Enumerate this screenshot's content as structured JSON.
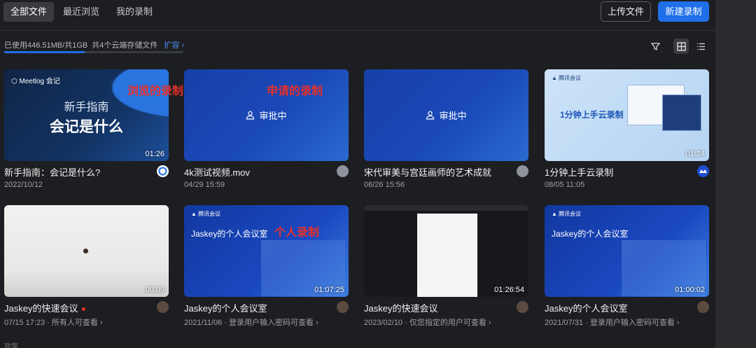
{
  "tabs": [
    {
      "label": "全部文件",
      "active": true
    },
    {
      "label": "最近浏览",
      "active": false
    },
    {
      "label": "我的录制",
      "active": false
    }
  ],
  "actions": {
    "upload": "上传文件",
    "new_recording": "新建录制"
  },
  "storage": {
    "used": "已使用446.51MB/共1GB",
    "count": "共4个云端存储文件",
    "expand": "扩容",
    "progress_fraction": 0.45
  },
  "annotations": {
    "browse": "浏览的录制",
    "apply": "申请的录制",
    "personal": "个人录制"
  },
  "cards": [
    {
      "thumb_title_small": "Meetlog 会记",
      "thumb_big_1": "新手指南",
      "thumb_big_2": "会记是什么",
      "duration": "01:26",
      "title": "新手指南：会记是什么?",
      "meta": "2022/10/12"
    },
    {
      "approval": "审批中",
      "title": "4k测试视频.mov",
      "meta": "04/29 15:59"
    },
    {
      "approval": "审批中",
      "title": "宋代审美与宫廷画师的艺术成就",
      "meta": "06/26 15:56"
    },
    {
      "thumb_logo": "腾讯会议",
      "thumb_caption": "1分钟上手云录制",
      "duration": "01:24",
      "title": "1分钟上手云录制",
      "meta": "08/05 11:05"
    },
    {
      "duration": "00:09",
      "title": "Jaskey的快速会议",
      "meta": "07/15 17:23 · 所有人可查看"
    },
    {
      "thumb_logo": "腾讯会议",
      "thumb_caption": "Jaskey的个人会议室",
      "duration": "01:07:25",
      "title": "Jaskey的个人会议室",
      "meta": "2021/11/06 · 登录用户输入密码可查看"
    },
    {
      "duration": "01:26:54",
      "title": "Jaskey的快速会议",
      "meta": "2023/02/10 · 仅您指定的用户可查看"
    },
    {
      "thumb_logo": "腾讯会议",
      "thumb_caption": "Jaskey的个人会议室",
      "duration": "01:00:02",
      "title": "Jaskey的个人会议室",
      "meta": "2021/07/31 · 登录用户输入密码可查看"
    }
  ],
  "footer": "政策",
  "colors": {
    "accent": "#1f6fe8",
    "annotation": "#e5302a",
    "background": "#1d1e21"
  },
  "icons": [
    "filter-icon",
    "grid-view-icon",
    "list-view-icon",
    "user-icon",
    "chevron-right-icon"
  ]
}
